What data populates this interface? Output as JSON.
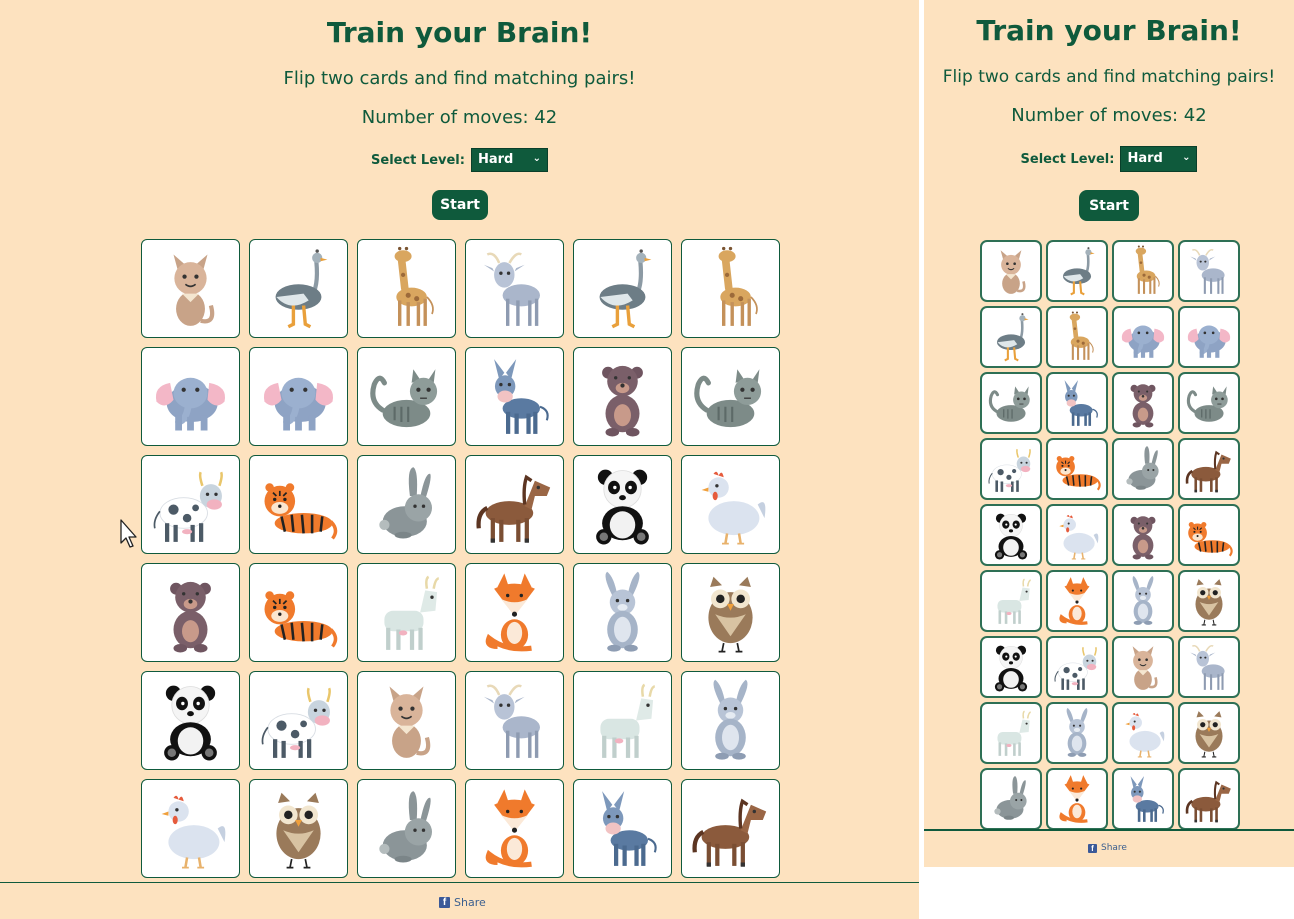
{
  "colors": {
    "background": "#fde2bf",
    "primary": "#0f5a3c",
    "card": "#ffffff",
    "facebook": "#3b5998"
  },
  "game": {
    "title": "Train your Brain!",
    "subtitle": "Flip two cards and find matching pairs!",
    "moves_label": "Number of moves: 42",
    "moves": 42,
    "level_label": "Select Level:",
    "level_value": "Hard",
    "start_label": "Start",
    "share_label": "Share"
  },
  "desktop_board": [
    [
      "cat",
      "ostrich",
      "giraffe",
      "goat",
      "ostrich",
      "giraffe"
    ],
    [
      "elephant",
      "elephant",
      "tabby",
      "donkey",
      "bear",
      "tabby"
    ],
    [
      "cow",
      "tiger",
      "rabbit",
      "horse",
      "panda",
      "chicken"
    ],
    [
      "bear",
      "tiger",
      "whitegoat",
      "fox",
      "hare",
      "owl"
    ],
    [
      "panda",
      "cow",
      "cat",
      "goat",
      "whitegoat",
      "hare"
    ],
    [
      "chicken",
      "owl",
      "rabbit",
      "fox",
      "donkey",
      "horse"
    ]
  ],
  "mobile_board": [
    [
      "cat",
      "ostrich",
      "giraffe",
      "goat"
    ],
    [
      "ostrich",
      "giraffe",
      "elephant",
      "elephant"
    ],
    [
      "tabby",
      "donkey",
      "bear",
      "tabby"
    ],
    [
      "cow",
      "tiger",
      "rabbit",
      "horse"
    ],
    [
      "panda",
      "chicken",
      "bear",
      "tiger"
    ],
    [
      "whitegoat",
      "fox",
      "hare",
      "owl"
    ],
    [
      "panda",
      "cow",
      "cat",
      "goat"
    ],
    [
      "whitegoat",
      "hare",
      "chicken",
      "owl"
    ],
    [
      "rabbit",
      "fox",
      "donkey",
      "horse"
    ]
  ]
}
